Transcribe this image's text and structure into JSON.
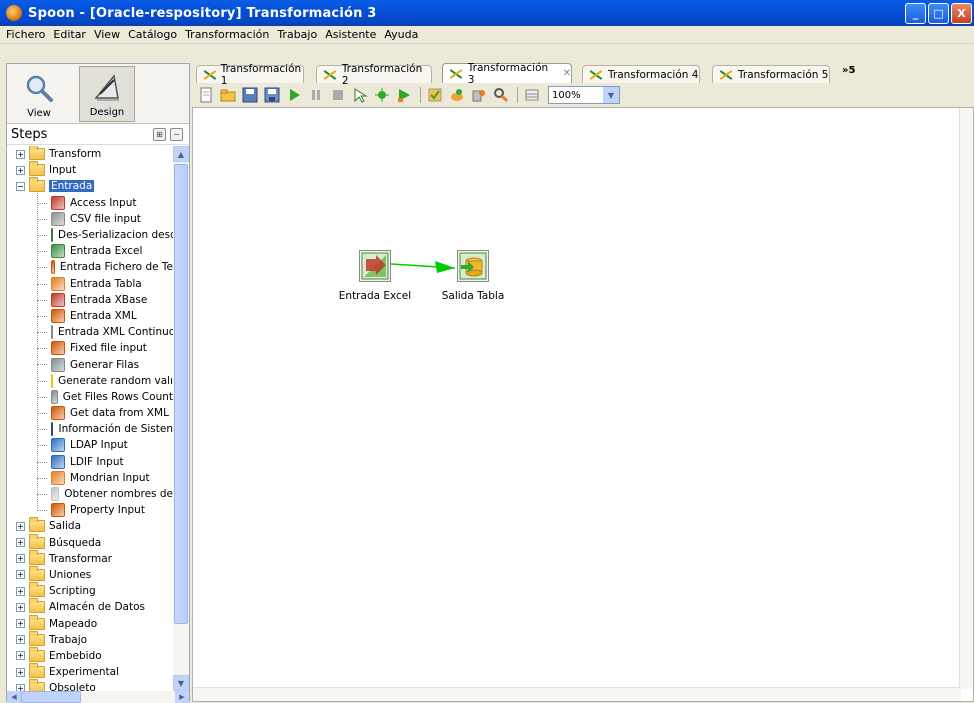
{
  "window": {
    "title": "Spoon - [Oracle-respository] Transformación 3",
    "minimize_label": "_",
    "maximize_label": "□",
    "close_label": "X"
  },
  "menu": [
    "Fichero",
    "Editar",
    "View",
    "Catálogo",
    "Transformación",
    "Trabajo",
    "Asistente",
    "Ayuda"
  ],
  "perspectives": {
    "view_label": "View",
    "design_label": "Design"
  },
  "steps_panel": {
    "title": "Steps",
    "tree": [
      {
        "label": "Transform",
        "expanded": false
      },
      {
        "label": "Input",
        "expanded": false
      },
      {
        "label": "Entrada",
        "expanded": true,
        "selected": true
      },
      {
        "label": "Access Input",
        "child": true,
        "icon": "access-input-icon",
        "color": "#c0392b"
      },
      {
        "label": "CSV file input",
        "child": true,
        "icon": "csv-input-icon",
        "color": "#8e8e8e"
      },
      {
        "label": "Des-Serializacion desd",
        "child": true,
        "icon": "deserialize-icon",
        "color": "#2e7d32"
      },
      {
        "label": "Entrada Excel",
        "child": true,
        "icon": "excel-input-icon",
        "color": "#388e3c"
      },
      {
        "label": "Entrada Fichero de Te",
        "child": true,
        "icon": "text-file-input-icon",
        "color": "#d35400"
      },
      {
        "label": "Entrada Tabla",
        "child": true,
        "icon": "table-input-icon",
        "color": "#e67e22"
      },
      {
        "label": "Entrada XBase",
        "child": true,
        "icon": "xbase-input-icon",
        "color": "#c0392b"
      },
      {
        "label": "Entrada XML",
        "child": true,
        "icon": "xml-input-icon",
        "color": "#d35400"
      },
      {
        "label": "Entrada XML Continuc",
        "child": true,
        "icon": "xml-stream-icon",
        "color": "#7f8c8d"
      },
      {
        "label": "Fixed file input",
        "child": true,
        "icon": "fixed-file-icon",
        "color": "#d35400"
      },
      {
        "label": "Generar Filas",
        "child": true,
        "icon": "generate-rows-icon",
        "color": "#7f8c8d"
      },
      {
        "label": "Generate random valı",
        "child": true,
        "icon": "random-value-icon",
        "color": "#f1c40f"
      },
      {
        "label": "Get Files Rows Count",
        "child": true,
        "icon": "files-rows-count-icon",
        "color": "#7f8c8d"
      },
      {
        "label": "Get data from XML",
        "child": true,
        "icon": "xml-data-icon",
        "color": "#d35400"
      },
      {
        "label": "Información de Sisten",
        "child": true,
        "icon": "system-info-icon",
        "color": "#34495e"
      },
      {
        "label": "LDAP Input",
        "child": true,
        "icon": "ldap-input-icon",
        "color": "#2c6fbf"
      },
      {
        "label": "LDIF Input",
        "child": true,
        "icon": "ldif-input-icon",
        "color": "#2c6fbf"
      },
      {
        "label": "Mondrian Input",
        "child": true,
        "icon": "mondrian-input-icon",
        "color": "#e67e22"
      },
      {
        "label": "Obtener nombres de",
        "child": true,
        "icon": "file-names-icon",
        "color": "#bdc3c7"
      },
      {
        "label": "Property Input",
        "child": true,
        "icon": "property-input-icon",
        "color": "#d35400"
      },
      {
        "label": "Salida",
        "expanded": false
      },
      {
        "label": "Búsqueda",
        "expanded": false
      },
      {
        "label": "Transformar",
        "expanded": false
      },
      {
        "label": "Uniones",
        "expanded": false
      },
      {
        "label": "Scripting",
        "expanded": false
      },
      {
        "label": "Almacén de Datos",
        "expanded": false
      },
      {
        "label": "Mapeado",
        "expanded": false
      },
      {
        "label": "Trabajo",
        "expanded": false
      },
      {
        "label": "Embebido",
        "expanded": false
      },
      {
        "label": "Experimental",
        "expanded": false
      },
      {
        "label": "Obsoleto",
        "expanded": false
      }
    ]
  },
  "tabs": [
    {
      "label": "Transformación 1",
      "active": false
    },
    {
      "label": "Transformación 2",
      "active": false
    },
    {
      "label": "Transformación 3",
      "active": true
    },
    {
      "label": "Transformación 4",
      "active": false
    },
    {
      "label": "Transformación 5",
      "active": false
    }
  ],
  "tab_overflow_label": "»5",
  "toolbar": {
    "zoom_value": "100%"
  },
  "canvas": {
    "nodes": [
      {
        "label": "Entrada Excel",
        "icon": "excel-input-icon"
      },
      {
        "label": "Salida Tabla",
        "icon": "table-output-icon"
      }
    ],
    "hop_color": "#00cc00"
  }
}
